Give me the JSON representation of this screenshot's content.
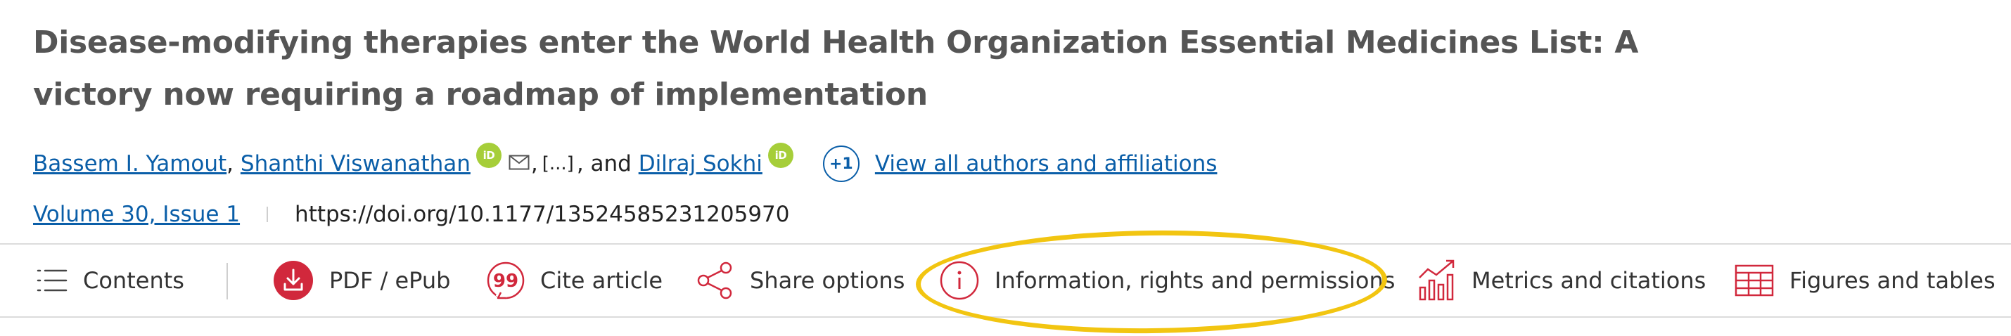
{
  "article": {
    "title": "Disease-modifying therapies enter the World Health Organization Essential Medicines List: A victory now requiring a roadmap of implementation"
  },
  "authors": {
    "author1": "Bassem I. Yamout",
    "author2": "Shanthi Viswanathan",
    "ellipsis": "[...]",
    "and": ", and",
    "author3": "Dilraj Sokhi",
    "orcid_label": "iD",
    "more_count": "+1",
    "view_all": "View all authors and affiliations"
  },
  "meta": {
    "volume_issue": "Volume 30, Issue 1",
    "doi": "https://doi.org/10.1177/13524585231205970"
  },
  "toolbar": {
    "items": [
      {
        "label": "Contents",
        "icon": "list-icon"
      },
      {
        "label": "PDF / ePub",
        "icon": "download-icon"
      },
      {
        "label": "Cite article",
        "icon": "quote-icon"
      },
      {
        "label": "Share options",
        "icon": "share-icon"
      },
      {
        "label": "Information, rights and permissions",
        "icon": "info-icon"
      },
      {
        "label": "Metrics and citations",
        "icon": "metrics-icon"
      },
      {
        "label": "Figures and tables",
        "icon": "table-icon"
      }
    ]
  },
  "colors": {
    "link": "#0a5ea8",
    "accent_red": "#d1283c",
    "orcid_green": "#a6ce39",
    "highlight_yellow": "#f2c511"
  }
}
